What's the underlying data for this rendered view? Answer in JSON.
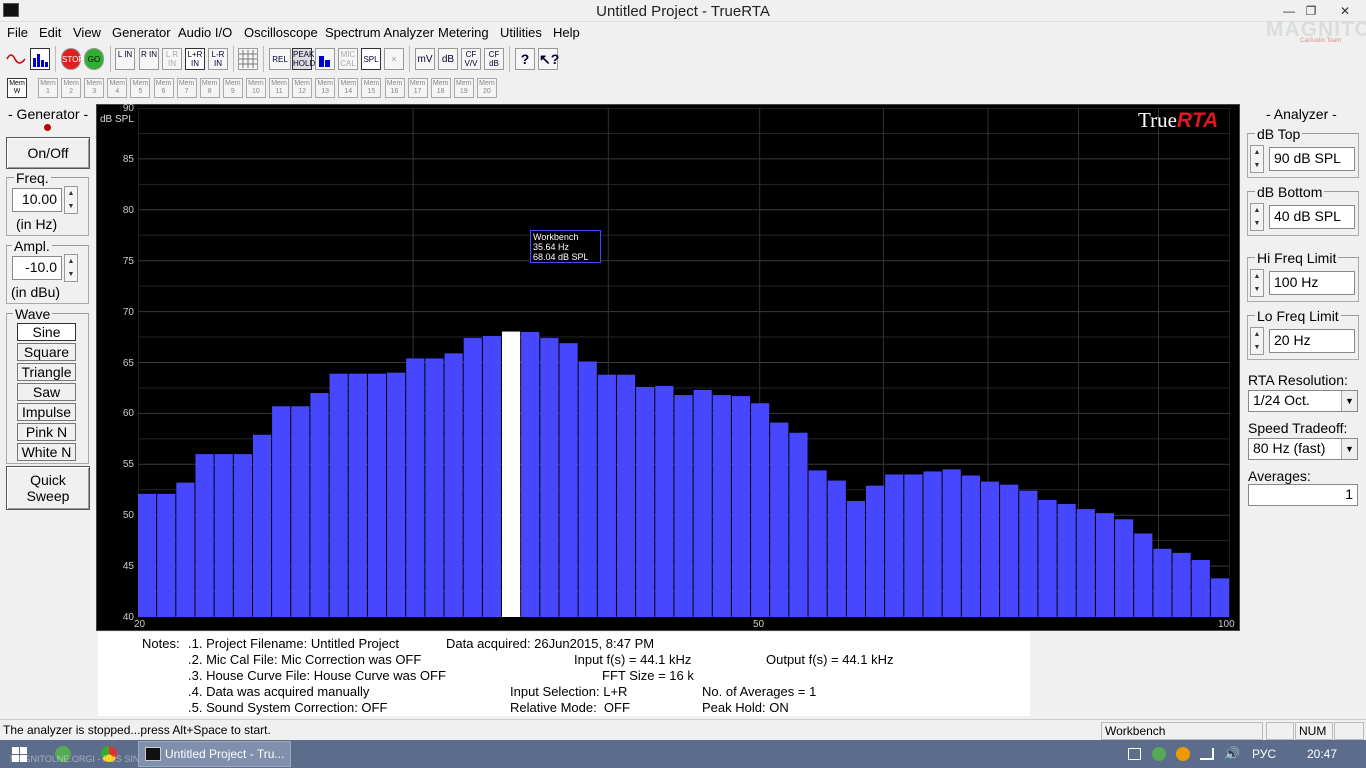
{
  "window": {
    "title": "Untitled Project - TrueRTA"
  },
  "menu": [
    "File",
    "Edit",
    "View",
    "Generator",
    "Audio I/O",
    "Oscilloscope",
    "Spectrum Analyzer",
    "Metering",
    "Utilities",
    "Help"
  ],
  "toolbar": {
    "stop": "STOP",
    "go": "GO",
    "l_in": "L IN",
    "r_in": "R IN",
    "lr_in": "L R IN",
    "lplusr_in": "L+R IN",
    "lminusr_in": "L-R IN",
    "rel": "REL",
    "peak_hold": "PEAK HOLD",
    "mic_cal": "MIC CAL",
    "spl": "SPL",
    "mv": "mV",
    "db": "dB",
    "cf_vv": "CF V/V",
    "cf_db": "CF dB"
  },
  "memory": {
    "mem_w": "Mem W",
    "slots": [
      "Mem 1",
      "Mem 2",
      "Mem 3",
      "Mem 4",
      "Mem 5",
      "Mem 6",
      "Mem 7",
      "Mem 8",
      "Mem 9",
      "Mem 10",
      "Mem 11",
      "Mem 12",
      "Mem 13",
      "Mem 14",
      "Mem 15",
      "Mem 16",
      "Mem 17",
      "Mem 18",
      "Mem 19",
      "Mem 20"
    ]
  },
  "generator": {
    "title": "- Generator -",
    "onoff": "On/Off",
    "freq_label": "Freq.",
    "freq_value": "10.00",
    "freq_unit": "(in Hz)",
    "ampl_label": "Ampl.",
    "ampl_value": "-10.0",
    "ampl_unit": "(in dBu)",
    "wave_label": "Wave",
    "waves": [
      "Sine",
      "Square",
      "Triangle",
      "Saw",
      "Impulse",
      "Pink N",
      "White N"
    ],
    "selected_wave": "Sine",
    "quick_sweep_1": "Quick",
    "quick_sweep_2": "Sweep"
  },
  "analyzer": {
    "title": "- Analyzer -",
    "db_top_label": "dB Top",
    "db_top_value": "90 dB SPL",
    "db_bottom_label": "dB Bottom",
    "db_bottom_value": "40 dB SPL",
    "hi_freq_label": "Hi Freq Limit",
    "hi_freq_value": "100 Hz",
    "lo_freq_label": "Lo Freq Limit",
    "lo_freq_value": "20 Hz",
    "resolution_label": "RTA Resolution:",
    "resolution_value": "1/24 Oct.",
    "speed_label": "Speed Tradeoff:",
    "speed_value": "80 Hz (fast)",
    "averages_label": "Averages:",
    "averages_value": "1"
  },
  "chart": {
    "brand_true": "True",
    "brand_rta": "RTA",
    "tooltip_name": "Workbench",
    "tooltip_freq": "35.64 Hz",
    "tooltip_level": "68.04 dB SPL",
    "bar_color": "#4747ff",
    "highlight_color": "#ffffff"
  },
  "chart_data": {
    "type": "bar",
    "ylabel": "dB SPL",
    "ylim": [
      40,
      90
    ],
    "yticks": [
      90,
      85,
      80,
      75,
      70,
      65,
      60,
      55,
      50,
      45,
      40
    ],
    "xscale": "log",
    "xlim": [
      20,
      100
    ],
    "xticks": [
      "20",
      "50",
      "100"
    ],
    "highlight_index": 19,
    "series": [
      {
        "values": [
          52.1,
          52.1,
          53.2,
          56.0,
          56.0,
          56.0,
          57.9,
          60.7,
          60.7,
          62.0,
          63.9,
          63.9,
          63.9,
          64.0,
          65.4,
          65.4,
          65.9,
          67.4,
          67.6,
          68.04,
          68.0,
          67.4,
          66.9,
          65.1,
          63.8,
          63.8,
          62.6,
          62.7,
          61.8,
          62.3,
          61.8,
          61.7,
          61.0,
          59.1,
          58.1,
          54.4,
          53.4,
          51.4,
          52.9,
          54.0,
          54.0,
          54.3,
          54.5,
          53.9,
          53.3,
          53.0,
          52.4,
          51.5,
          51.1,
          50.6,
          50.2,
          49.6,
          48.2,
          46.7,
          46.3,
          45.6,
          43.8
        ]
      }
    ]
  },
  "notes": {
    "label": "Notes:",
    "n1": ".1. Project Filename: Untitled Project",
    "acquired": "Data acquired: 26Jun2015, 8:47 PM",
    "n2": ".2. Mic Cal File: Mic Correction was OFF",
    "input_fs": "Input f(s) = 44.1 kHz",
    "output_fs": "Output f(s) = 44.1 kHz",
    "n3": ".3. House Curve File: House Curve was OFF",
    "fft": "FFT Size = 16 k",
    "n4": ".4. Data was acquired manually",
    "input_sel": "Input Selection: L+R",
    "averages": "No. of Averages = 1",
    "n5": ".5. Sound System Correction: OFF",
    "relative": "Relative Mode:  OFF",
    "peak": "Peak Hold: ON"
  },
  "status": {
    "message": "The analyzer is stopped...press Alt+Space to start.",
    "workbench": "Workbench",
    "num": "NUM"
  },
  "taskbar": {
    "watermark": "MAGNITOLNE.ORGI - RUS SINETJ",
    "active_task": "Untitled Project - Tru...",
    "lang": "РУС",
    "clock": "20:47"
  },
  "watermark": {
    "text": "MAGNITOLA",
    "sub": "CarAudio Team"
  }
}
